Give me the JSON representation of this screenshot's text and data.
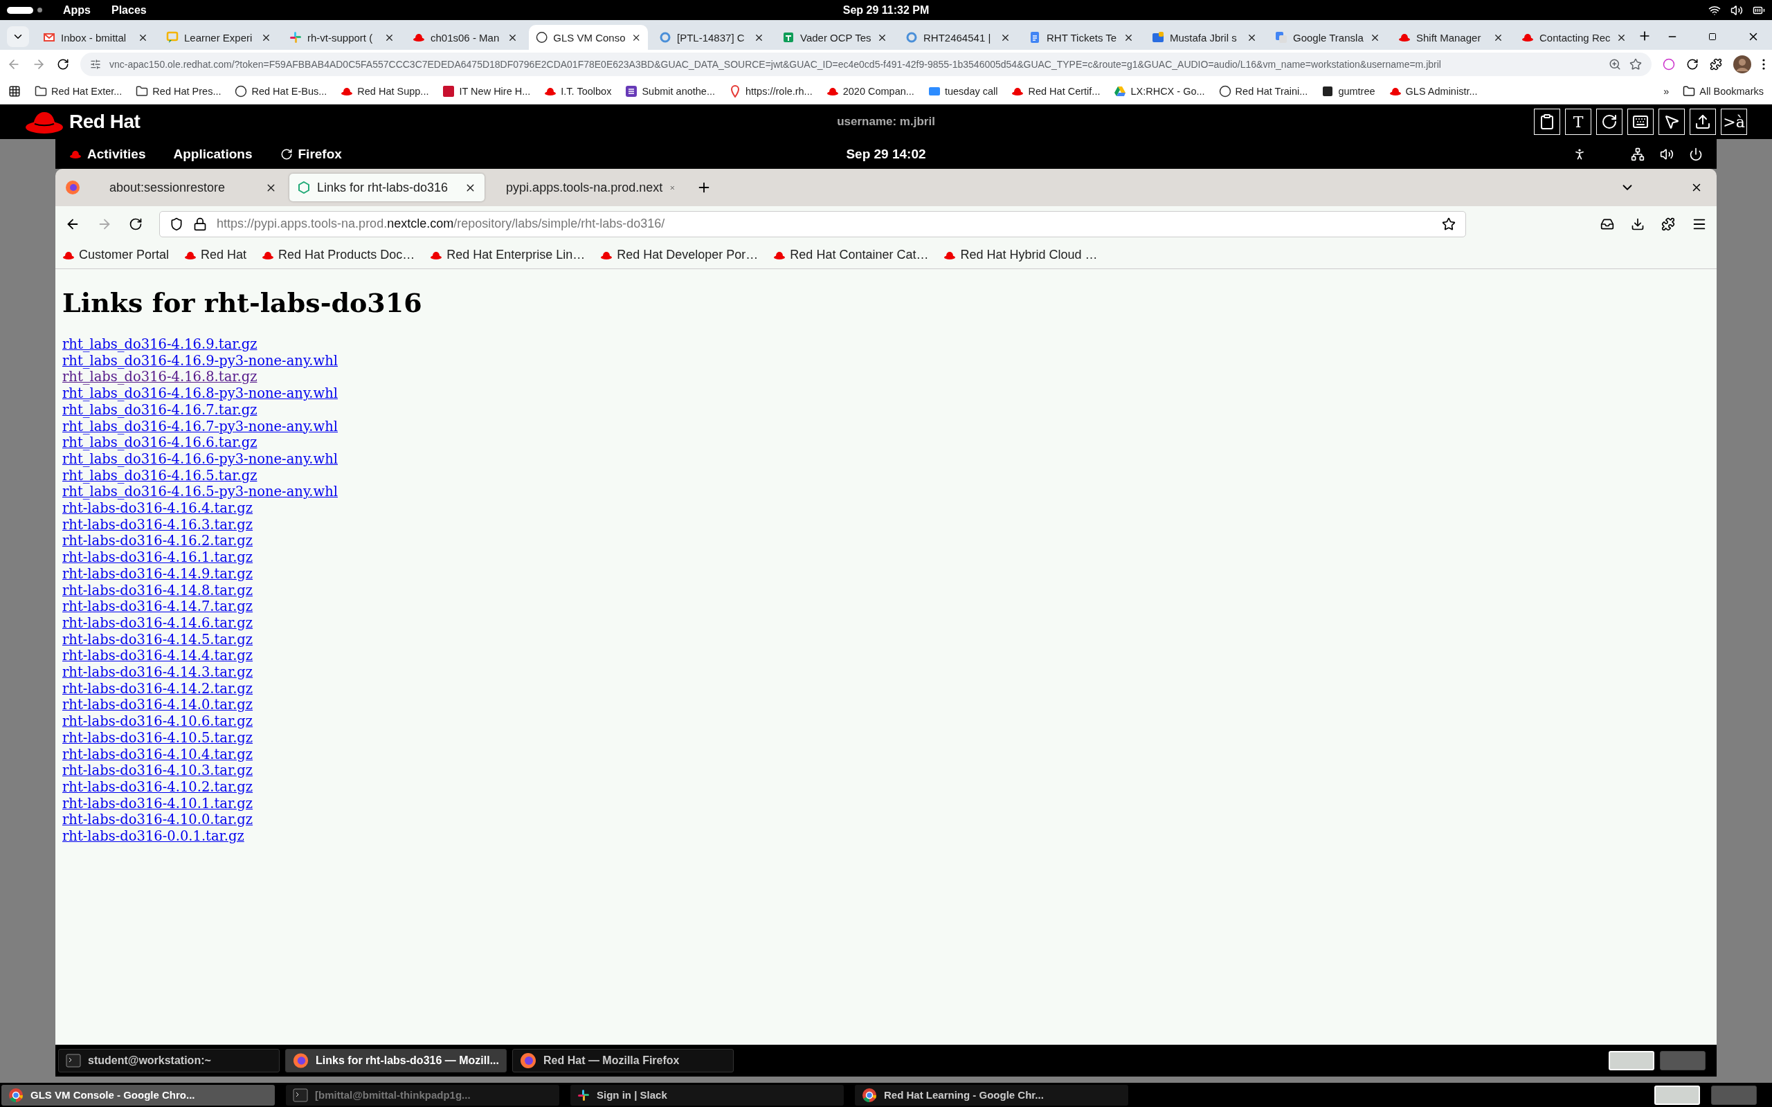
{
  "system_bar": {
    "apps": "Apps",
    "places": "Places",
    "clock": "Sep 29  11:32 PM"
  },
  "chrome": {
    "tabs": [
      {
        "title": "Inbox - bmittal",
        "selected": false
      },
      {
        "title": "Learner Experi",
        "selected": false
      },
      {
        "title": "rh-vt-support (",
        "selected": false
      },
      {
        "title": "ch01s06 - Man",
        "selected": false
      },
      {
        "title": "GLS VM Conso",
        "selected": true
      },
      {
        "title": "[PTL-14837] C",
        "selected": false
      },
      {
        "title": "Vader OCP Tes",
        "selected": false
      },
      {
        "title": "RHT2464541 |",
        "selected": false
      },
      {
        "title": "RHT Tickets Te",
        "selected": false
      },
      {
        "title": "Mustafa Jbril s",
        "selected": false
      },
      {
        "title": "Google Transla",
        "selected": false
      },
      {
        "title": "Shift Manager",
        "selected": false
      },
      {
        "title": "Contacting Rec",
        "selected": false
      }
    ],
    "url": "vnc-apac150.ole.redhat.com/?token=F59AFBBAB4AD0C5FA557CCC3C7EDEDA6475D18DF0796E2CDA01F78E0E623A3BD&GUAC_DATA_SOURCE=jwt&GUAC_ID=ec4e0cd5-f491-42f9-9855-1b3546005d54&GUAC_TYPE=c&route=g1&GUAC_AUDIO=audio/L16&vm_name=workstation&username=m.jbril",
    "bookmarks": [
      "Red Hat Exter...",
      "Red Hat Pres...",
      "Red Hat E-Bus...",
      "Red Hat Supp...",
      "IT New Hire H...",
      "I.T. Toolbox",
      "Submit anothe...",
      "https://role.rh...",
      "2020 Compan...",
      "tuesday call",
      "Red Hat Certif...",
      "LX:RHCX - Go...",
      "Red Hat Traini...",
      "gumtree",
      "GLS Administr..."
    ],
    "more": "»",
    "all_bookmarks": "All Bookmarks"
  },
  "vnc": {
    "brand": "Red Hat",
    "username": "username: m.jbril",
    "tools": [
      {
        "kind": "clipboard"
      },
      {
        "kind": "text",
        "label": "T"
      },
      {
        "kind": "spinner"
      },
      {
        "kind": "keyboard"
      },
      {
        "kind": "mouse-off"
      },
      {
        "kind": "upload"
      },
      {
        "kind": "text",
        "label": ">à"
      }
    ]
  },
  "remote_bar": {
    "activities": "Activities",
    "applications": "Applications",
    "firefox": "Firefox",
    "clock": "Sep 29  14:02"
  },
  "firefox": {
    "tabs": [
      {
        "title": "about:sessionrestore",
        "selected": false
      },
      {
        "title": "Links for rht-labs-do316",
        "selected": true
      },
      {
        "title": "pypi.apps.tools-na.prod.next",
        "selected": false
      }
    ],
    "url": {
      "prefix": "https://pypi.apps.tools-na.prod.",
      "domain": "nextcle.com",
      "path": "/repository/labs/simple/rht-labs-do316/"
    },
    "bookmarks": [
      "Customer Portal",
      "Red Hat",
      "Red Hat Products Doc…",
      "Red Hat Enterprise Lin…",
      "Red Hat Developer Por…",
      "Red Hat Container Cat…",
      "Red Hat Hybrid Cloud …"
    ]
  },
  "page": {
    "heading": "Links for rht-labs-do316",
    "links": [
      {
        "text": "rht_labs_do316-4.16.9.tar.gz",
        "visited": false
      },
      {
        "text": "rht_labs_do316-4.16.9-py3-none-any.whl",
        "visited": false
      },
      {
        "text": "rht_labs_do316-4.16.8.tar.gz",
        "visited": true
      },
      {
        "text": "rht_labs_do316-4.16.8-py3-none-any.whl",
        "visited": false
      },
      {
        "text": "rht_labs_do316-4.16.7.tar.gz",
        "visited": false
      },
      {
        "text": "rht_labs_do316-4.16.7-py3-none-any.whl",
        "visited": false
      },
      {
        "text": "rht_labs_do316-4.16.6.tar.gz",
        "visited": false
      },
      {
        "text": "rht_labs_do316-4.16.6-py3-none-any.whl",
        "visited": false
      },
      {
        "text": "rht_labs_do316-4.16.5.tar.gz",
        "visited": false
      },
      {
        "text": "rht_labs_do316-4.16.5-py3-none-any.whl",
        "visited": false
      },
      {
        "text": "rht-labs-do316-4.16.4.tar.gz",
        "visited": false
      },
      {
        "text": "rht-labs-do316-4.16.3.tar.gz",
        "visited": false
      },
      {
        "text": "rht-labs-do316-4.16.2.tar.gz",
        "visited": false
      },
      {
        "text": "rht-labs-do316-4.16.1.tar.gz",
        "visited": false
      },
      {
        "text": "rht-labs-do316-4.14.9.tar.gz",
        "visited": false
      },
      {
        "text": "rht-labs-do316-4.14.8.tar.gz",
        "visited": false
      },
      {
        "text": "rht-labs-do316-4.14.7.tar.gz",
        "visited": false
      },
      {
        "text": "rht-labs-do316-4.14.6.tar.gz",
        "visited": false
      },
      {
        "text": "rht-labs-do316-4.14.5.tar.gz",
        "visited": false
      },
      {
        "text": "rht-labs-do316-4.14.4.tar.gz",
        "visited": false
      },
      {
        "text": "rht-labs-do316-4.14.3.tar.gz",
        "visited": false
      },
      {
        "text": "rht-labs-do316-4.14.2.tar.gz",
        "visited": false
      },
      {
        "text": "rht-labs-do316-4.14.0.tar.gz",
        "visited": false
      },
      {
        "text": "rht-labs-do316-4.10.6.tar.gz",
        "visited": false
      },
      {
        "text": "rht-labs-do316-4.10.5.tar.gz",
        "visited": false
      },
      {
        "text": "rht-labs-do316-4.10.4.tar.gz",
        "visited": false
      },
      {
        "text": "rht-labs-do316-4.10.3.tar.gz",
        "visited": false
      },
      {
        "text": "rht-labs-do316-4.10.2.tar.gz",
        "visited": false
      },
      {
        "text": "rht-labs-do316-4.10.1.tar.gz",
        "visited": false
      },
      {
        "text": "rht-labs-do316-4.10.0.tar.gz",
        "visited": false
      },
      {
        "text": "rht-labs-do316-0.0.1.tar.gz",
        "visited": false
      }
    ]
  },
  "remote_taskbar": {
    "windows": [
      {
        "title": "student@workstation:~",
        "selected": false
      },
      {
        "title": "Links for rht-labs-do316 — Mozill...",
        "selected": true
      },
      {
        "title": "Red Hat — Mozilla Firefox",
        "selected": false
      }
    ],
    "workspaces": [
      {
        "selected": true
      },
      {
        "selected": false
      }
    ]
  },
  "host_taskbar": {
    "windows": [
      {
        "title": "GLS VM Console - Google Chro...",
        "selected": true,
        "dimmed": false
      },
      {
        "title": "[bmittal@bmittal-thinkpadp1g...",
        "selected": false,
        "dimmed": true
      },
      {
        "title": "Sign in | Slack",
        "selected": false,
        "dimmed": false
      },
      {
        "title": "Red Hat Learning - Google Chr...",
        "selected": false,
        "dimmed": false
      }
    ],
    "workspaces": [
      {
        "selected": true
      },
      {
        "selected": false
      }
    ]
  }
}
